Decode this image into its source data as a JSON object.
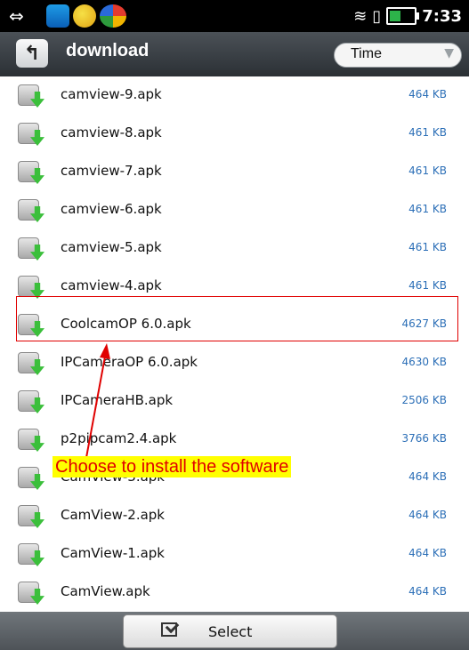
{
  "status_bar": {
    "usb_icon": "usb-icon",
    "app_icons": [
      "app-icon-1",
      "app-icon-2",
      "app-icon-3"
    ],
    "wifi_icon": "wifi-icon",
    "vibrate_icon": "vibrate-icon",
    "battery_icon": "battery-charging-icon",
    "time": "7:33"
  },
  "header": {
    "up_icon": "up-arrow-icon",
    "folder": "download",
    "sort_label": "Time"
  },
  "files": [
    {
      "name": "camview-9.apk",
      "size": "464 KB"
    },
    {
      "name": "camview-8.apk",
      "size": "461 KB"
    },
    {
      "name": "camview-7.apk",
      "size": "461 KB"
    },
    {
      "name": "camview-6.apk",
      "size": "461 KB"
    },
    {
      "name": "camview-5.apk",
      "size": "461 KB"
    },
    {
      "name": "camview-4.apk",
      "size": "461 KB"
    },
    {
      "name": "CoolcamOP 6.0.apk",
      "size": "4627 KB"
    },
    {
      "name": "IPCameraOP 6.0.apk",
      "size": "4630 KB"
    },
    {
      "name": "IPCameraHB.apk",
      "size": "2506 KB"
    },
    {
      "name": "p2pipcam2.4.apk",
      "size": "3766 KB"
    },
    {
      "name": "CamView-3.apk",
      "size": "464 KB"
    },
    {
      "name": "CamView-2.apk",
      "size": "464 KB"
    },
    {
      "name": "CamView-1.apk",
      "size": "464 KB"
    },
    {
      "name": "CamView.apk",
      "size": "464 KB"
    }
  ],
  "annotation": {
    "text": "Choose  to  install the  software",
    "color": "#e00000",
    "highlight_color": "#ffff00"
  },
  "bottom": {
    "select_label": "Select"
  }
}
